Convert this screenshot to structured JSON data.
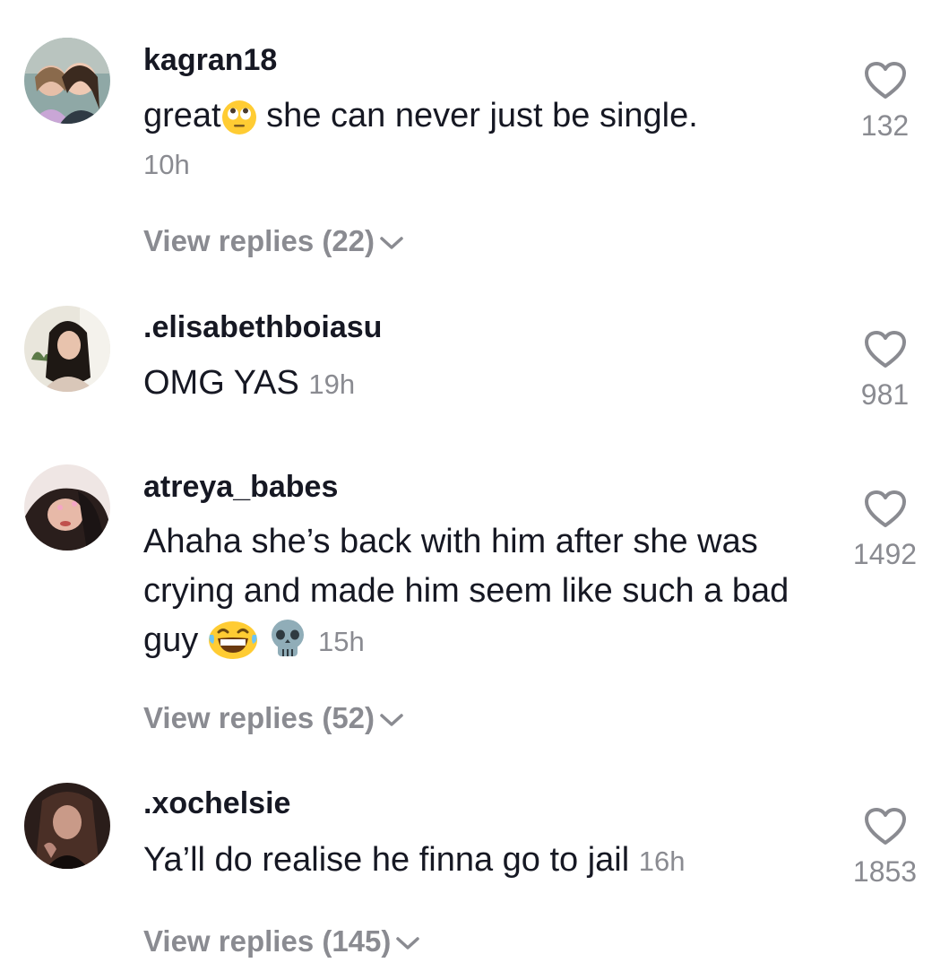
{
  "comments": [
    {
      "username": "kagran18",
      "text_before_emoji": "great",
      "text_after_emoji": " she can never just be single.",
      "emoji": "eye-roll-emoji",
      "time": "10h",
      "likes": "132",
      "replies_label": "View replies (22)"
    },
    {
      "username": ".elisabethboiasu",
      "text": "OMG YAS",
      "time": "19h",
      "likes": "981"
    },
    {
      "username": "atreya_babes",
      "text": "Ahaha she’s back with him after she was crying and made him seem like such a bad guy",
      "emojis": [
        "laughing-emoji",
        "skull-emoji"
      ],
      "time": "15h",
      "likes": "1492",
      "replies_label": "View replies (52)"
    },
    {
      "username": ".xochelsie",
      "text": "Ya’ll do realise he finna go to jail",
      "time": "16h",
      "likes": "1853",
      "replies_label": "View replies (145)"
    }
  ],
  "colors": {
    "text": "#161823",
    "muted": "#8a8b91",
    "background": "#ffffff"
  }
}
